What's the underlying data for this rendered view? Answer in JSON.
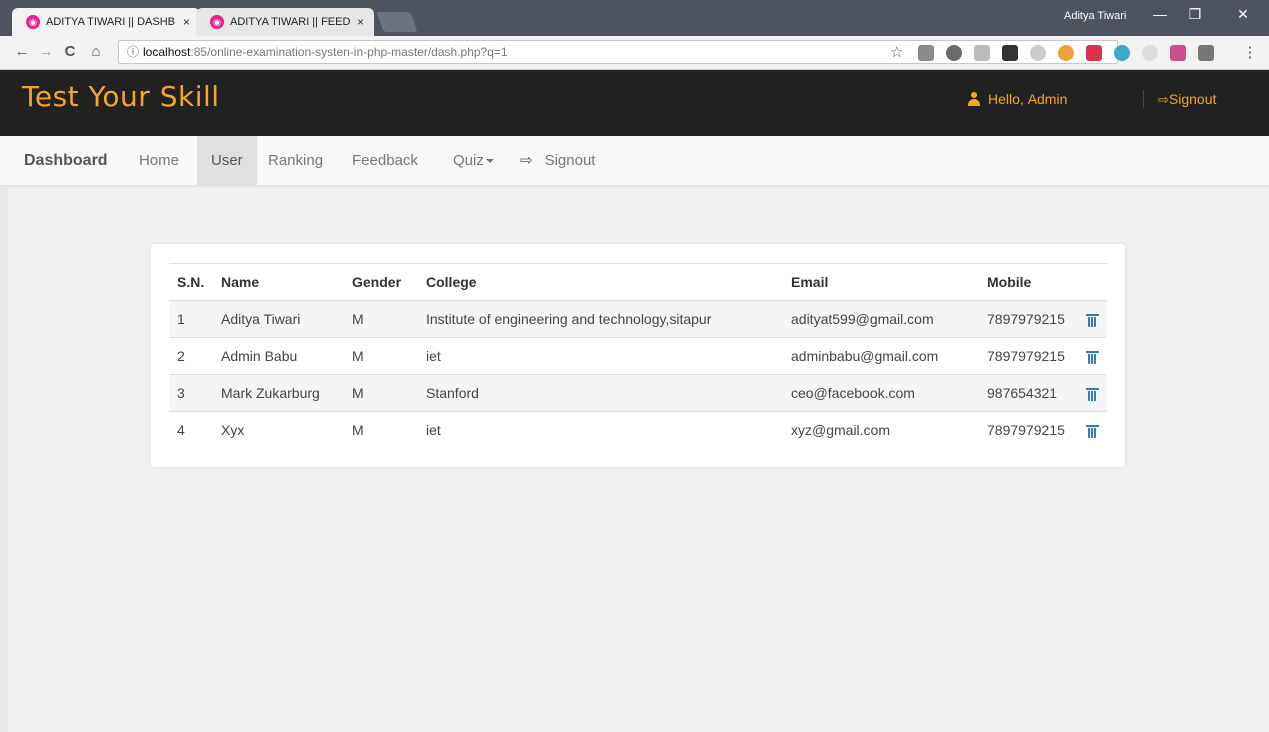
{
  "browser": {
    "tabs": [
      {
        "title": "ADITYA TIWARI || DASHB",
        "close": "×"
      },
      {
        "title": "ADITYA TIWARI || FEEDB/",
        "close": "×"
      }
    ],
    "profile_name": "Aditya Tiwari",
    "window_controls": [
      "—",
      "❐",
      "✕"
    ],
    "url_host": "localhost",
    "url_rest": ":85/online-examination-systen-in-php-master/dash.php?q=1",
    "url_info_glyph": "ⓘ",
    "nav_glyphs": {
      "back": "←",
      "forward": "→",
      "reload": "C",
      "home": "⌂"
    },
    "star_glyph": "☆",
    "menu_glyph": "⋮"
  },
  "header": {
    "logo": "Test Your Skill",
    "hello_prefix": "Hello,",
    "hello_name": "Admin",
    "signout": "Signout",
    "accent_color": "#f5a623"
  },
  "navbar": {
    "brand": "Dashboard",
    "items": [
      "Home",
      "User",
      "Ranking",
      "Feedback",
      "Quiz"
    ],
    "signout": "Signout",
    "active": "User"
  },
  "users_table": {
    "columns": [
      "S.N.",
      "Name",
      "Gender",
      "College",
      "Email",
      "Mobile"
    ],
    "rows": [
      {
        "sn": "1",
        "name": "Aditya Tiwari",
        "gender": "M",
        "college": "Institute of engineering and technology,sitapur",
        "email": "adityat599@gmail.com",
        "mobile": "7897979215"
      },
      {
        "sn": "2",
        "name": "Admin Babu",
        "gender": "M",
        "college": "iet",
        "email": "adminbabu@gmail.com",
        "mobile": "7897979215"
      },
      {
        "sn": "3",
        "name": "Mark Zukarburg",
        "gender": "M",
        "college": "Stanford",
        "email": "ceo@facebook.com",
        "mobile": "987654321"
      },
      {
        "sn": "4",
        "name": "Xyx",
        "gender": "M",
        "college": "iet",
        "email": "xyz@gmail.com",
        "mobile": "7897979215"
      }
    ],
    "delete_icon": "trash-icon"
  }
}
